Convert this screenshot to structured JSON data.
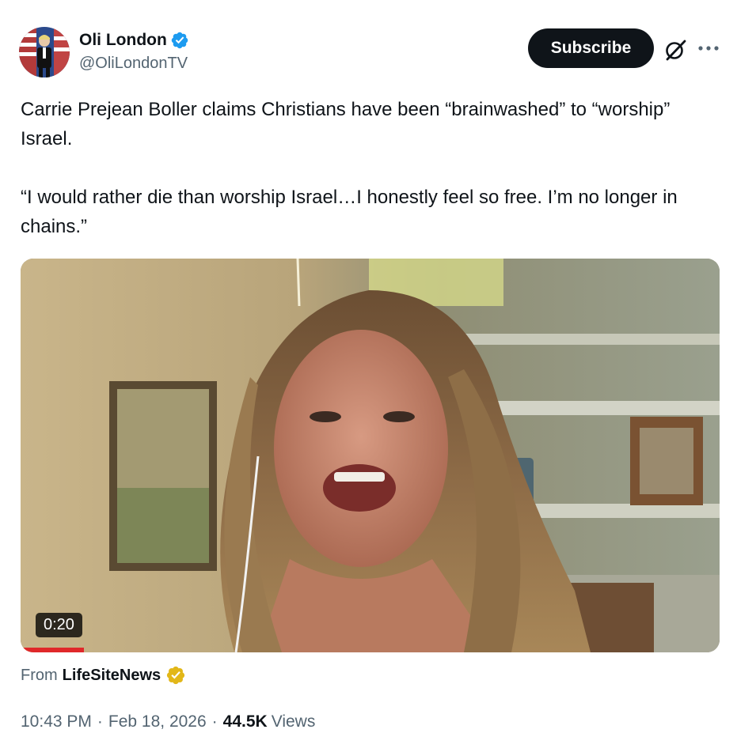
{
  "author": {
    "display_name": "Oli London",
    "handle": "@OliLondonTV",
    "verified_color": "#1d9bf0"
  },
  "header": {
    "subscribe_label": "Subscribe",
    "grok_icon": "grok-icon",
    "more_icon": "more-icon"
  },
  "tweet": {
    "line1": "Carrie Prejean Boller claims Christians have been “brainwashed” to “worship” Israel.",
    "line2": "“I would rather die than worship Israel…I honestly feel so free. I’m no longer in chains.”"
  },
  "media": {
    "duration": "0:20"
  },
  "source": {
    "from_label": "From",
    "name": "LifeSiteNews",
    "badge_color": "#e2b719"
  },
  "meta": {
    "time": "10:43 PM",
    "separator": "·",
    "date": "Feb 18, 2026",
    "views_count": "44.5K",
    "views_label": "Views"
  }
}
